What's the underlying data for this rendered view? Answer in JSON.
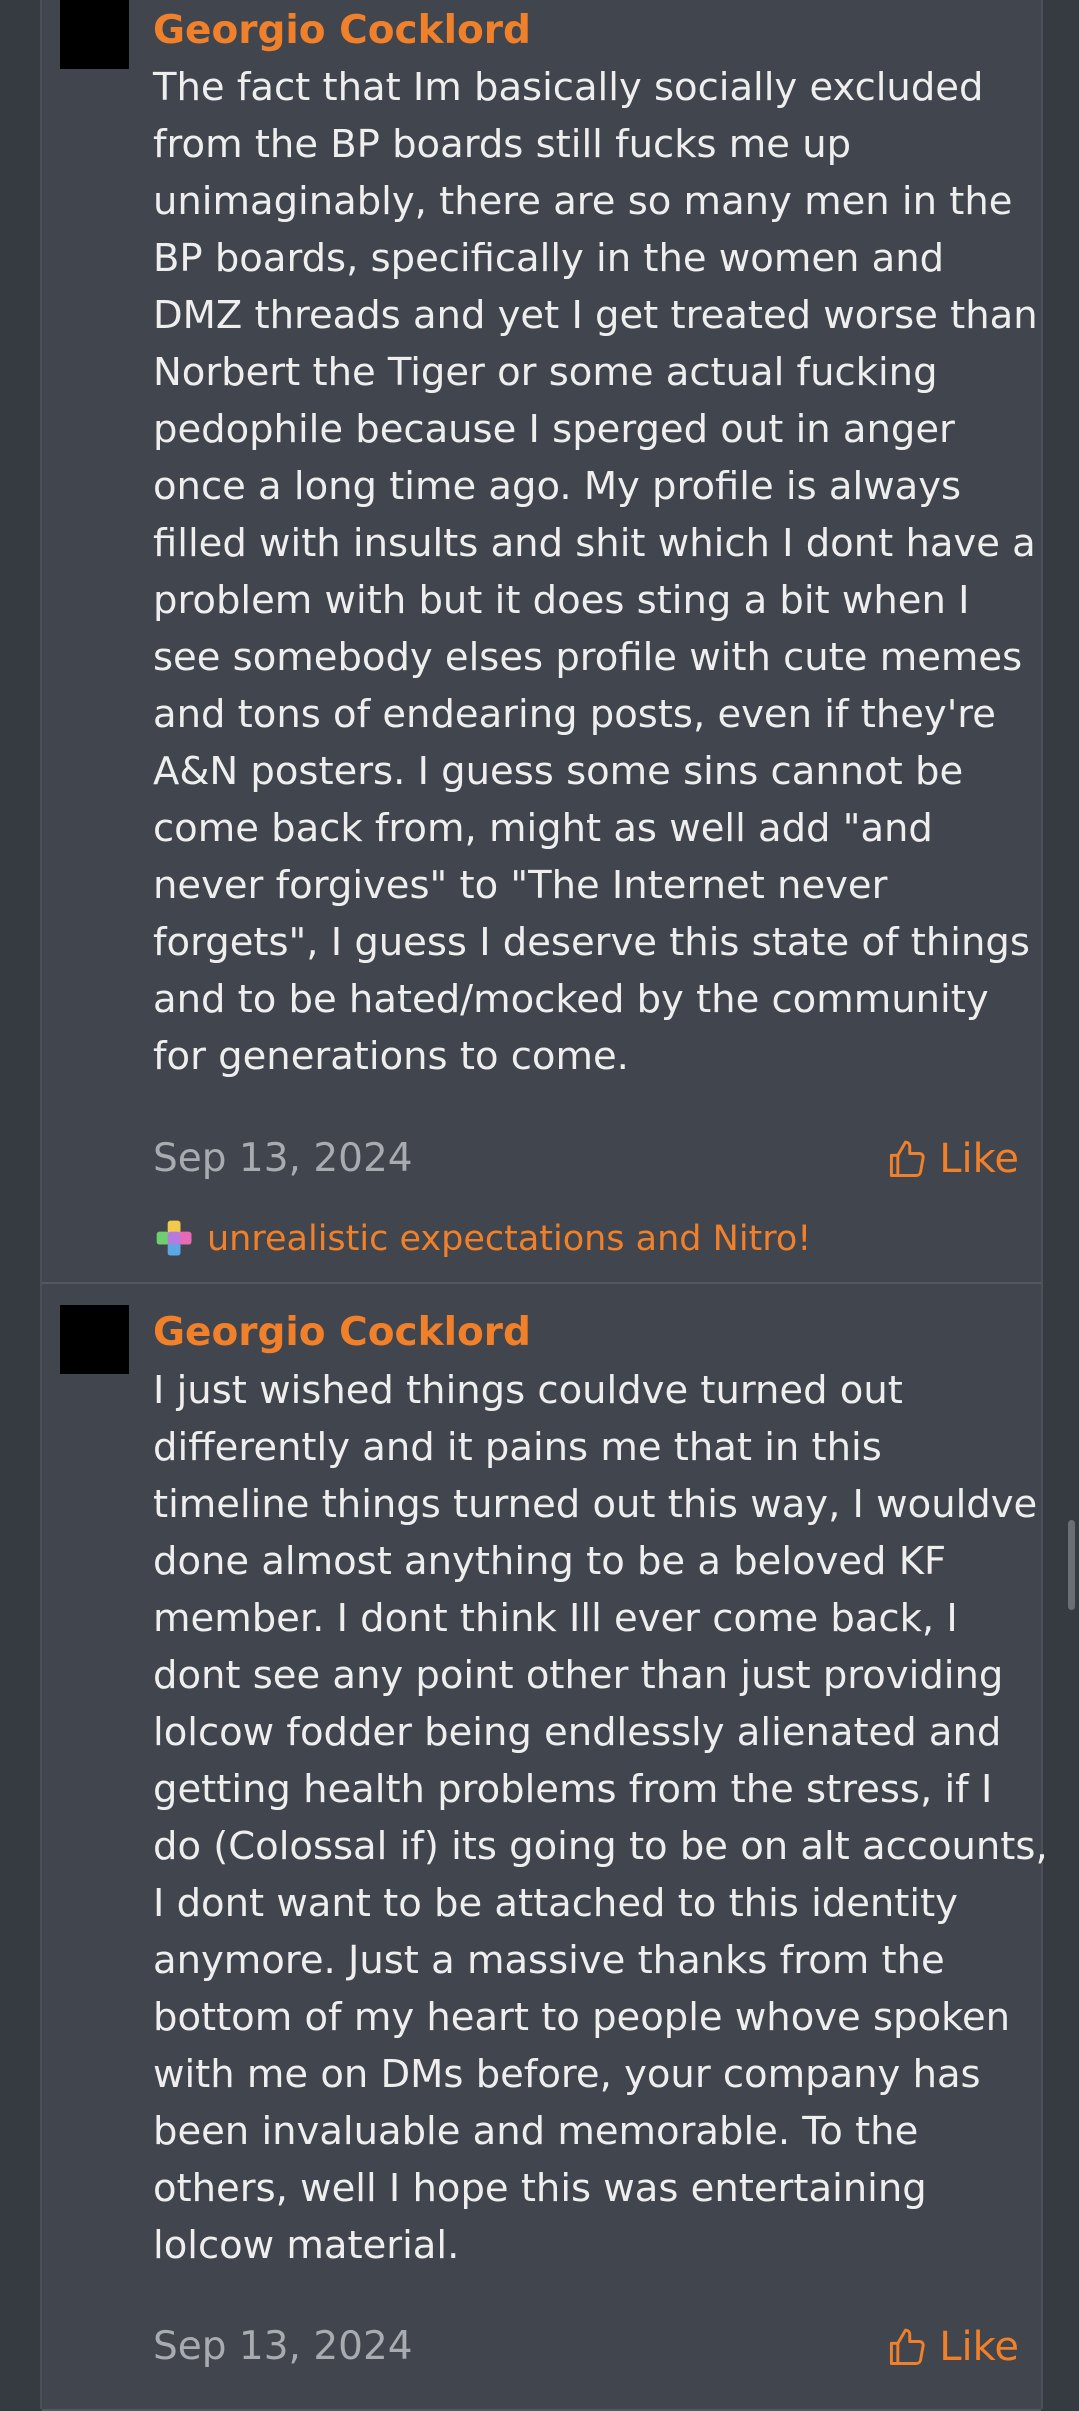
{
  "posts": [
    {
      "author": "Georgio Cocklord",
      "lines": [
        "The fact that Im basically socially excluded",
        "from the BP boards still fucks me up",
        "unimaginably, there are so many men in the",
        "BP boards, specifically in the women and",
        "DMZ threads and yet I get treated worse than",
        "Norbert the Tiger or some actual fucking",
        "pedophile because I sperged out in anger",
        "once a long time ago. My profile is always",
        "filled with insults and shit which I dont have a",
        "problem with but it does sting a bit when I",
        "see somebody elses profile with cute memes",
        "and tons of endearing posts, even if they're",
        "A&N posters. I guess some sins cannot be",
        "come back from, might as well add \"and",
        "never forgives\" to \"The Internet never",
        "forgets\", I guess I deserve this state of things",
        "and to be hated/mocked by the community",
        "for generations to come."
      ],
      "date": "Sep 13, 2024",
      "like_label": "Like",
      "reactions_text": "unrealistic expectations and Nitro!"
    },
    {
      "author": "Georgio Cocklord",
      "lines": [
        "I just wished things couldve turned out",
        "differently and it pains me that in this",
        "timeline things turned out this way, I wouldve",
        "done almost anything to be a beloved KF",
        "member. I dont think Ill ever come back, I",
        "dont see any point other than just providing",
        "lolcow fodder being endlessly alienated and",
        "getting health problems from the stress, if I",
        "do (Colossal if) its going to be on alt accounts,",
        "I dont want to be attached to this identity",
        "anymore. Just a massive thanks from the",
        "bottom of my heart to people whove spoken",
        "with me on DMs before, your company has",
        "been invaluable and memorable. To the",
        "others, well I hope this was entertaining",
        "lolcow material."
      ],
      "date": "Sep 13, 2024",
      "like_label": "Like"
    }
  ],
  "colors": {
    "accent": "#f0802a",
    "post_bg": "#41454d",
    "page_bg": "#363a41",
    "text": "#eeeeef",
    "muted": "#a8abb0"
  },
  "icons": {
    "like": "thumbs-up-icon",
    "reaction": "puzzle-pieces-icon"
  }
}
